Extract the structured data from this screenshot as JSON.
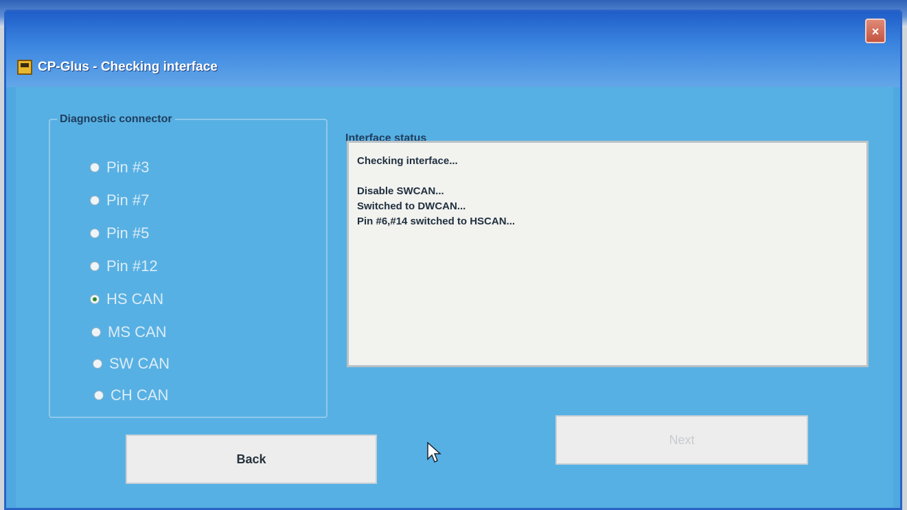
{
  "window": {
    "title": "CP-Glus - Checking interface",
    "close_label": "×"
  },
  "diagnostic": {
    "group_label": "Diagnostic connector",
    "options": [
      {
        "label": "Pin #3",
        "checked": false
      },
      {
        "label": "Pin #7",
        "checked": false
      },
      {
        "label": "Pin #5",
        "checked": false
      },
      {
        "label": "Pin #12",
        "checked": false
      },
      {
        "label": "HS CAN",
        "checked": true
      },
      {
        "label": "MS CAN",
        "checked": false
      },
      {
        "label": "SW CAN",
        "checked": false
      },
      {
        "label": "CH CAN",
        "checked": false
      }
    ]
  },
  "status": {
    "label": "Interface status",
    "lines": [
      "Checking interface...",
      "",
      "Disable SWCAN...",
      "Switched to DWCAN...",
      "Pin #6,#14 switched to HSCAN..."
    ]
  },
  "buttons": {
    "back_label": "Back",
    "next_label": "Next"
  }
}
